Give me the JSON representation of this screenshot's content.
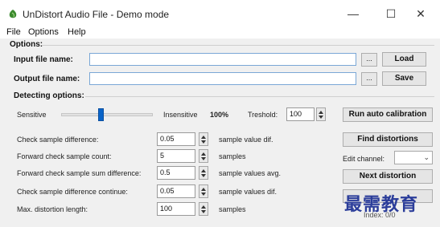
{
  "window": {
    "title": "UnDistort Audio File - Demo mode",
    "controls": {
      "minimize": "—",
      "maximize": "☐",
      "close": "✕"
    }
  },
  "menu": {
    "items": [
      "File",
      "Options",
      "Help"
    ]
  },
  "options": {
    "group_label": "Options:",
    "input_file_label": "Input file name:",
    "input_file_value": "",
    "output_file_label": "Output file name:",
    "output_file_value": "",
    "browse_label": "...",
    "load_label": "Load",
    "save_label": "Save"
  },
  "detecting": {
    "group_label": "Detecting options:",
    "sensitive_label": "Sensitive",
    "insensitive_label": "Insensitive",
    "sensitivity_value": "100%",
    "sensitivity_level": 0.43,
    "threshold_label": "Treshold:",
    "threshold_value": "100",
    "params": [
      {
        "label": "Check sample difference:",
        "value": "0.05",
        "unit": "sample value dif."
      },
      {
        "label": "Forward check sample count:",
        "value": "5",
        "unit": "samples"
      },
      {
        "label": "Forward check sample sum difference:",
        "value": "0.5",
        "unit": "sample values avg."
      },
      {
        "label": "Check sample difference continue:",
        "value": "0.05",
        "unit": "sample values dif."
      },
      {
        "label": "Max. distortion length:",
        "value": "100",
        "unit": "samples"
      }
    ]
  },
  "actions": {
    "run_calibration": "Run auto calibration",
    "find_distortions": "Find distortions",
    "edit_channel_label": "Edit channel:",
    "edit_channel_value": "",
    "next_distortion": "Next distortion",
    "index_label": "Index: 0/0"
  },
  "watermark": {
    "text": "最需教育"
  },
  "colors": {
    "accent": "#0a64c8",
    "watermark": "#2b3d9a",
    "input_border": "#7aa7d6"
  }
}
